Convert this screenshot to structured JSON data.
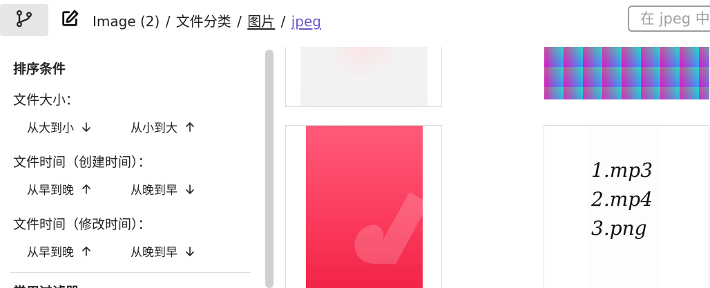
{
  "header": {
    "branch_icon": "git-branch-icon",
    "edit_icon": "edit-icon",
    "breadcrumb": {
      "root": "Image (2)",
      "level1": "文件分类",
      "level2": "图片",
      "current": "jpeg",
      "separator": "/"
    },
    "search_placeholder": "在 jpeg 中搜索"
  },
  "sidebar": {
    "title": "排序条件",
    "groups": [
      {
        "label": "文件大小：",
        "options": [
          {
            "label": "从大到小",
            "dir": "down"
          },
          {
            "label": "从小到大",
            "dir": "up"
          }
        ]
      },
      {
        "label": "文件时间（创建时间）：",
        "options": [
          {
            "label": "从早到晚",
            "dir": "up"
          },
          {
            "label": "从晚到早",
            "dir": "down"
          }
        ]
      },
      {
        "label": "文件时间（修改时间）：",
        "options": [
          {
            "label": "从早到晚",
            "dir": "up"
          },
          {
            "label": "从晚到早",
            "dir": "down"
          }
        ]
      }
    ],
    "next_section_title": "常用过滤器"
  },
  "grid": {
    "handwriting_lines": [
      "1.mp3",
      "2.mp4",
      "3.png"
    ]
  }
}
